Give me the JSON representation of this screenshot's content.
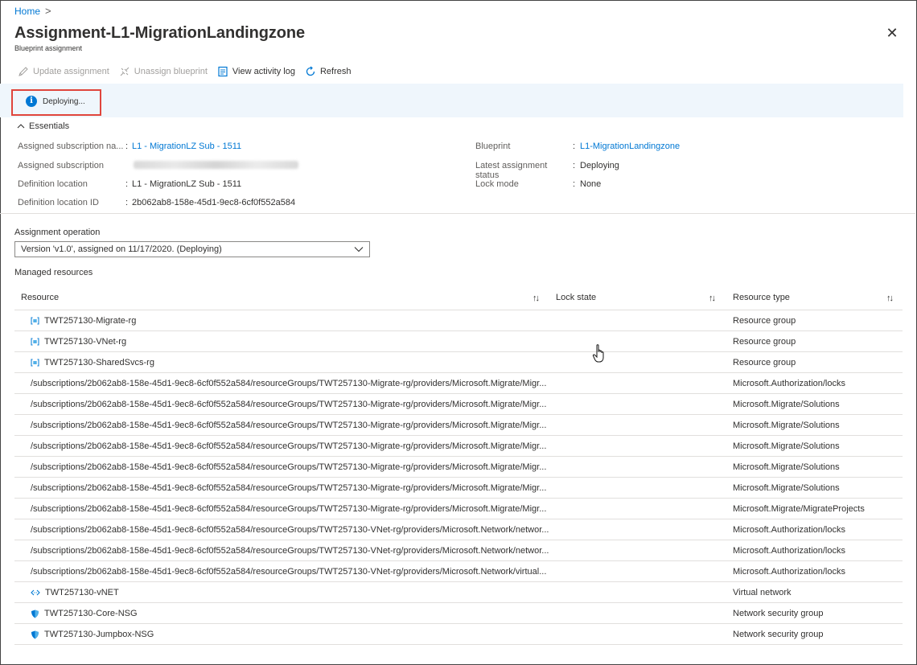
{
  "breadcrumb": {
    "home": "Home",
    "separator": ">"
  },
  "header": {
    "title": "Assignment-L1-MigrationLandingzone",
    "subtitle": "Blueprint assignment",
    "close_glyph": "✕"
  },
  "toolbar": {
    "update": "Update assignment",
    "unassign": "Unassign blueprint",
    "activity": "View activity log",
    "refresh": "Refresh"
  },
  "banner": {
    "text": "Deploying..."
  },
  "essentials": {
    "toggle_label": "Essentials",
    "left": [
      {
        "label": "Assigned subscription na...",
        "value": "L1 - MigrationLZ Sub - 1511",
        "link": true
      },
      {
        "label": "Assigned subscription",
        "value": "",
        "redacted": true
      },
      {
        "label": "Definition location",
        "value": "L1 - MigrationLZ Sub - 1511",
        "link": false
      },
      {
        "label": "Definition location ID",
        "value": "2b062ab8-158e-45d1-9ec8-6cf0f552a584",
        "link": false
      }
    ],
    "right": [
      {
        "label": "Blueprint",
        "value": "L1-MigrationLandingzone",
        "link": true
      },
      {
        "label": "Latest assignment status",
        "value": "Deploying",
        "link": false
      },
      {
        "label": "Lock mode",
        "value": "None",
        "link": false
      }
    ]
  },
  "assignment_operation": {
    "label": "Assignment operation",
    "selected": "Version 'v1.0', assigned on 11/17/2020. (Deploying)"
  },
  "managed_resources": {
    "label": "Managed resources",
    "columns": {
      "resource": "Resource",
      "lock_state": "Lock state",
      "resource_type": "Resource type"
    },
    "sort_glyph": "↑↓",
    "rows": [
      {
        "icon": "resource-group-icon",
        "resource": "TWT257130-Migrate-rg",
        "type": "Resource group"
      },
      {
        "icon": "resource-group-icon",
        "resource": "TWT257130-VNet-rg",
        "type": "Resource group"
      },
      {
        "icon": "resource-group-icon",
        "resource": "TWT257130-SharedSvcs-rg",
        "type": "Resource group"
      },
      {
        "icon": "",
        "resource": "/subscriptions/2b062ab8-158e-45d1-9ec8-6cf0f552a584/resourceGroups/TWT257130-Migrate-rg/providers/Microsoft.Migrate/Migr...",
        "type": "Microsoft.Authorization/locks"
      },
      {
        "icon": "",
        "resource": "/subscriptions/2b062ab8-158e-45d1-9ec8-6cf0f552a584/resourceGroups/TWT257130-Migrate-rg/providers/Microsoft.Migrate/Migr...",
        "type": "Microsoft.Migrate/Solutions"
      },
      {
        "icon": "",
        "resource": "/subscriptions/2b062ab8-158e-45d1-9ec8-6cf0f552a584/resourceGroups/TWT257130-Migrate-rg/providers/Microsoft.Migrate/Migr...",
        "type": "Microsoft.Migrate/Solutions"
      },
      {
        "icon": "",
        "resource": "/subscriptions/2b062ab8-158e-45d1-9ec8-6cf0f552a584/resourceGroups/TWT257130-Migrate-rg/providers/Microsoft.Migrate/Migr...",
        "type": "Microsoft.Migrate/Solutions"
      },
      {
        "icon": "",
        "resource": "/subscriptions/2b062ab8-158e-45d1-9ec8-6cf0f552a584/resourceGroups/TWT257130-Migrate-rg/providers/Microsoft.Migrate/Migr...",
        "type": "Microsoft.Migrate/Solutions"
      },
      {
        "icon": "",
        "resource": "/subscriptions/2b062ab8-158e-45d1-9ec8-6cf0f552a584/resourceGroups/TWT257130-Migrate-rg/providers/Microsoft.Migrate/Migr...",
        "type": "Microsoft.Migrate/Solutions"
      },
      {
        "icon": "",
        "resource": "/subscriptions/2b062ab8-158e-45d1-9ec8-6cf0f552a584/resourceGroups/TWT257130-Migrate-rg/providers/Microsoft.Migrate/Migr...",
        "type": "Microsoft.Migrate/MigrateProjects"
      },
      {
        "icon": "",
        "resource": "/subscriptions/2b062ab8-158e-45d1-9ec8-6cf0f552a584/resourceGroups/TWT257130-VNet-rg/providers/Microsoft.Network/networ...",
        "type": "Microsoft.Authorization/locks"
      },
      {
        "icon": "",
        "resource": "/subscriptions/2b062ab8-158e-45d1-9ec8-6cf0f552a584/resourceGroups/TWT257130-VNet-rg/providers/Microsoft.Network/networ...",
        "type": "Microsoft.Authorization/locks"
      },
      {
        "icon": "",
        "resource": "/subscriptions/2b062ab8-158e-45d1-9ec8-6cf0f552a584/resourceGroups/TWT257130-VNet-rg/providers/Microsoft.Network/virtual...",
        "type": "Microsoft.Authorization/locks"
      },
      {
        "icon": "virtual-network-icon",
        "resource": "TWT257130-vNET",
        "type": "Virtual network"
      },
      {
        "icon": "network-security-group-icon",
        "resource": "TWT257130-Core-NSG",
        "type": "Network security group"
      },
      {
        "icon": "network-security-group-icon",
        "resource": "TWT257130-Jumpbox-NSG",
        "type": "Network security group"
      }
    ]
  },
  "colors": {
    "link": "#0078d4",
    "banner_bg": "#eff6fc",
    "highlight_box": "#e0453c",
    "disabled_text": "#a19f9d"
  }
}
